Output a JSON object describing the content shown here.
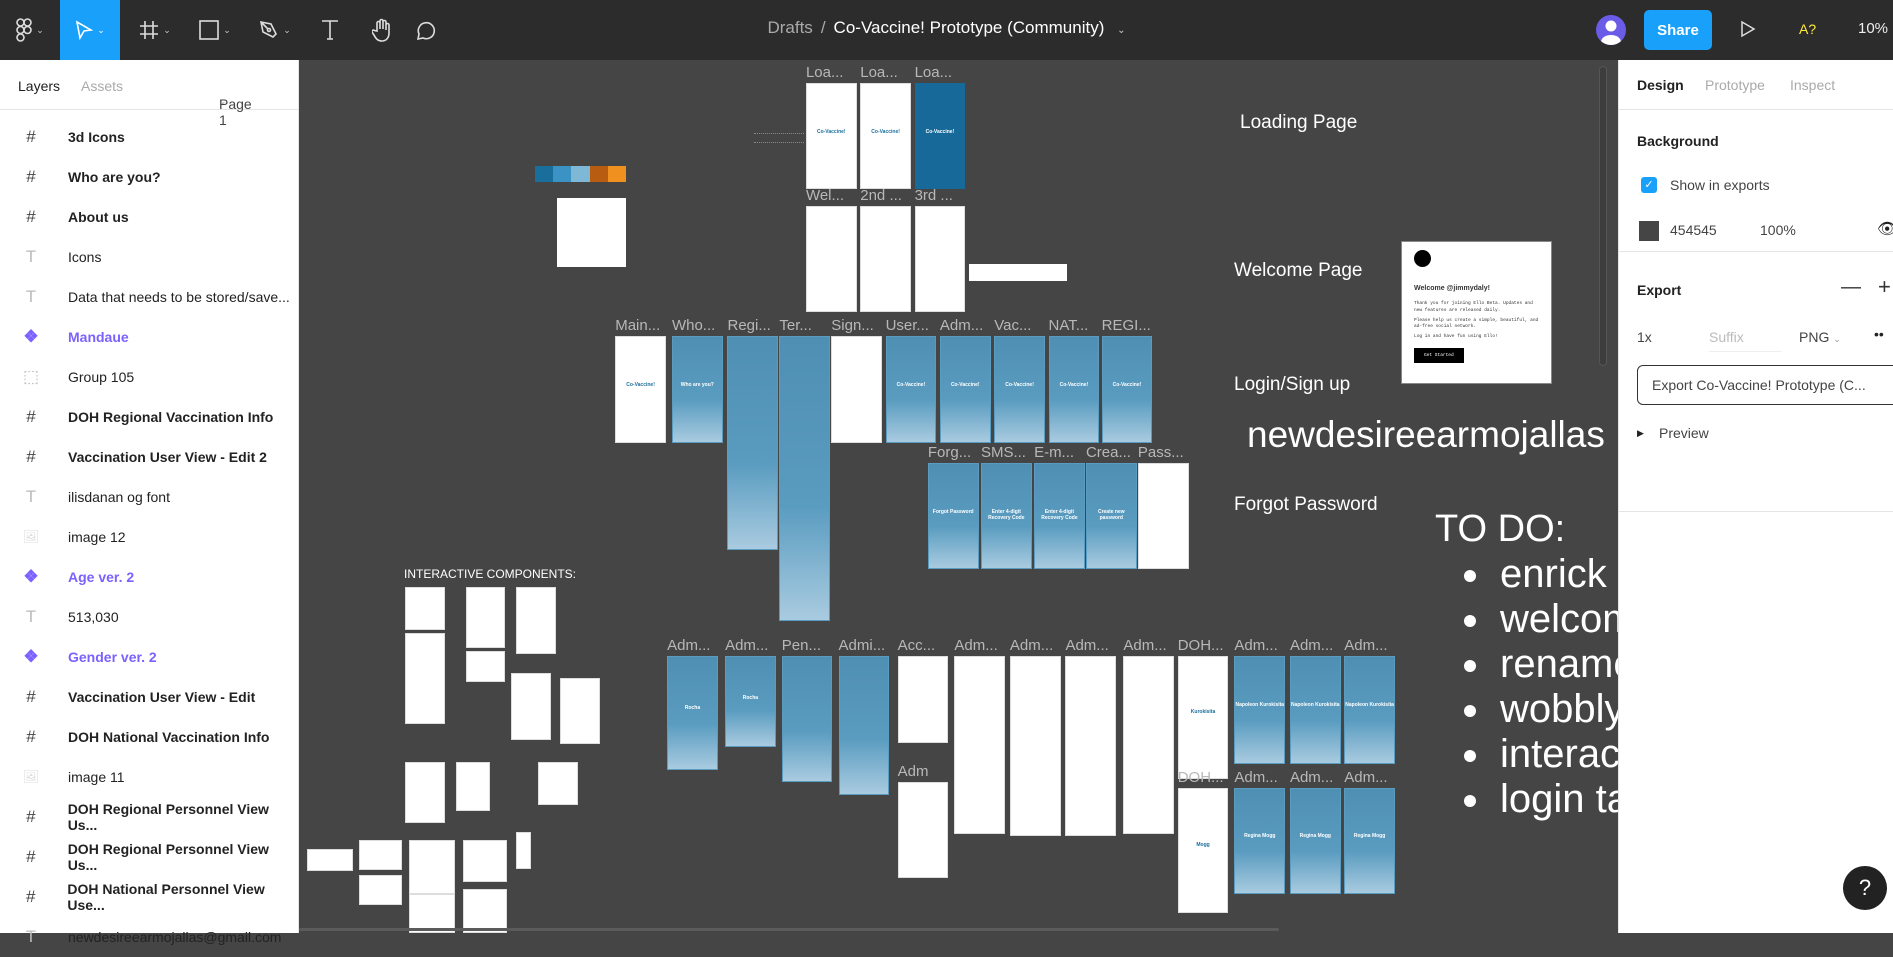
{
  "toolbar": {
    "breadcrumb": "Drafts",
    "separator": "/",
    "file_title": "Co-Vaccine! Prototype (Community)",
    "share_label": "Share",
    "a11y_label": "A?",
    "zoom_level": "10%",
    "active_tool": "move",
    "accent": "#18a0fb"
  },
  "left_panel": {
    "tabs": [
      "Layers",
      "Assets"
    ],
    "page": "Page 1",
    "layers": [
      {
        "type": "frame",
        "name": "3d Icons"
      },
      {
        "type": "frame",
        "name": "Who are you?"
      },
      {
        "type": "frame",
        "name": "About us"
      },
      {
        "type": "text",
        "name": "Icons"
      },
      {
        "type": "text",
        "name": "Data that needs to be stored/save..."
      },
      {
        "type": "component",
        "name": "Mandaue"
      },
      {
        "type": "group",
        "name": "Group 105"
      },
      {
        "type": "frame",
        "name": "DOH Regional Vaccination Info"
      },
      {
        "type": "frame",
        "name": "Vaccination User View - Edit 2"
      },
      {
        "type": "text",
        "name": "ilisdanan og font"
      },
      {
        "type": "image",
        "name": "image 12"
      },
      {
        "type": "component",
        "name": "Age ver. 2"
      },
      {
        "type": "text",
        "name": "513,030"
      },
      {
        "type": "component",
        "name": "Gender ver. 2"
      },
      {
        "type": "frame",
        "name": "Vaccination User View - Edit"
      },
      {
        "type": "frame",
        "name": "DOH National Vaccination Info"
      },
      {
        "type": "image",
        "name": "image 11"
      },
      {
        "type": "frame",
        "name": "DOH Regional Personnel View Us..."
      },
      {
        "type": "frame",
        "name": "DOH Regional Personnel View Us..."
      },
      {
        "type": "frame",
        "name": "DOH National Personnel View Use..."
      },
      {
        "type": "text",
        "name": "newdesireearmojallas@gmail.com"
      }
    ]
  },
  "canvas": {
    "section_labels": [
      "Loading Page",
      "Welcome Page",
      "Login/Sign up",
      "Forgot Password"
    ],
    "big_text": "newdesireearmojallas",
    "interactive_label": "INTERACTIVE COMPONENTS:",
    "todo_title": "TO DO:",
    "todo_items": [
      "enrick c",
      "welcom",
      "rename",
      "wobbly",
      "interact",
      "login ta"
    ],
    "email_card": {
      "heading": "Welcome @jimmydaly!",
      "body1": "Thank you for joining Ello Beta. Updates and new features are released daily.",
      "body2": "Please help us create a simple, beautiful, and ad-free social network.",
      "body3": "Log in and have fun using Ello!",
      "button": "Get Started"
    },
    "frames": [
      {
        "label": "Loa...",
        "theme": "white",
        "text": "Co-Vaccine!"
      },
      {
        "label": "Loa...",
        "theme": "white",
        "text": "Co-Vaccine!"
      },
      {
        "label": "Loa...",
        "theme": "dark",
        "text": "Co-Vaccine!"
      },
      {
        "label": "Wel...",
        "theme": "white"
      },
      {
        "label": "2nd ...",
        "theme": "white"
      },
      {
        "label": "3rd ...",
        "theme": "white"
      },
      {
        "label": "Main...",
        "theme": "white",
        "text": "Co-Vaccine!"
      },
      {
        "label": "Who...",
        "theme": "blue",
        "text": "Who are you?"
      },
      {
        "label": "Regi...",
        "theme": "blue"
      },
      {
        "label": "Ter...",
        "theme": "blue"
      },
      {
        "label": "Sign...",
        "theme": "white"
      },
      {
        "label": "User...",
        "theme": "blue",
        "text": "Co-Vaccine!"
      },
      {
        "label": "Adm...",
        "theme": "blue",
        "text": "Co-Vaccine!"
      },
      {
        "label": "Vac...",
        "theme": "blue",
        "text": "Co-Vaccine!"
      },
      {
        "label": "NAT...",
        "theme": "blue",
        "text": "Co-Vaccine!"
      },
      {
        "label": "REGI...",
        "theme": "blue",
        "text": "Co-Vaccine!"
      },
      {
        "label": "Forg...",
        "theme": "blue",
        "text": "Forgot Password"
      },
      {
        "label": "SMS...",
        "theme": "blue",
        "text": "Enter 4-digit Recovery Code"
      },
      {
        "label": "E-m...",
        "theme": "blue",
        "text": "Enter 4-digit Recovery Code"
      },
      {
        "label": "Crea...",
        "theme": "blue",
        "text": "Create new password"
      },
      {
        "label": "Pass...",
        "theme": "white"
      },
      {
        "label": "Adm...",
        "theme": "blue",
        "text": "Rocha"
      },
      {
        "label": "Adm...",
        "theme": "blue",
        "text": "Rocha"
      },
      {
        "label": "Pen...",
        "theme": "blue"
      },
      {
        "label": "Admi...",
        "theme": "blue"
      },
      {
        "label": "Acc...",
        "theme": "white"
      },
      {
        "label": "Adm...",
        "theme": "white"
      },
      {
        "label": "Adm...",
        "theme": "white"
      },
      {
        "label": "Adm...",
        "theme": "white"
      },
      {
        "label": "Adm...",
        "theme": "white"
      },
      {
        "label": "DOH...",
        "theme": "white",
        "text": "Kurokisita"
      },
      {
        "label": "Adm...",
        "theme": "blue",
        "text": "Napoleon Kurokisita"
      },
      {
        "label": "Adm...",
        "theme": "blue",
        "text": "Napoleon Kurokisita"
      },
      {
        "label": "Adm...",
        "theme": "blue",
        "text": "Napoleon Kurokisita"
      },
      {
        "label": "Adm",
        "theme": "white"
      },
      {
        "label": "DOH...",
        "theme": "white",
        "text": "Mogg"
      },
      {
        "label": "Adm...",
        "theme": "blue",
        "text": "Regina Mogg"
      },
      {
        "label": "Adm...",
        "theme": "blue",
        "text": "Regina Mogg"
      },
      {
        "label": "Adm...",
        "theme": "blue",
        "text": "Regina Mogg"
      }
    ],
    "palette": [
      "#1a6e9c",
      "#3a93c4",
      "#7fb7d6",
      "#b85c12",
      "#f0901e"
    ]
  },
  "right_panel": {
    "tabs": [
      "Design",
      "Prototype",
      "Inspect"
    ],
    "background": {
      "title": "Background",
      "hex": "454545",
      "opacity": "100%",
      "swatch": "#454545"
    },
    "show_in_exports": {
      "label": "Show in exports",
      "checked": true
    },
    "export": {
      "title": "Export",
      "scale": "1x",
      "suffix_placeholder": "Suffix",
      "format": "PNG",
      "button": "Export Co-Vaccine! Prototype (C...",
      "preview": "Preview"
    }
  },
  "help_label": "?"
}
